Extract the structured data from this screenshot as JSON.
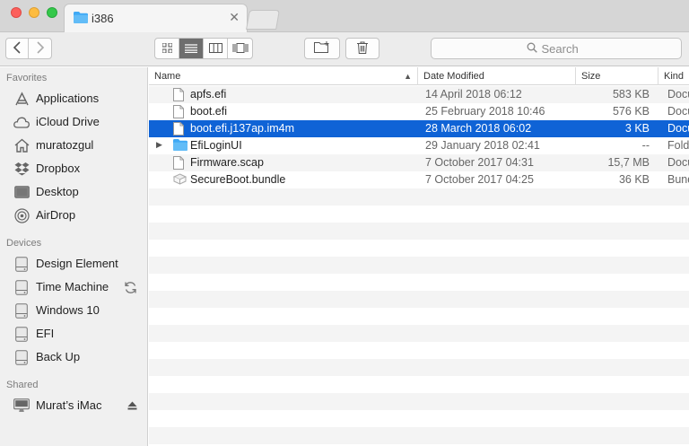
{
  "window": {
    "tab_title": "i386",
    "tab_close": "✕"
  },
  "toolbar": {
    "search_placeholder": "Search"
  },
  "sidebar": {
    "sections": [
      {
        "title": "Favorites",
        "items": [
          {
            "label": "Applications",
            "icon": "applications-icon"
          },
          {
            "label": "iCloud Drive",
            "icon": "cloud-icon"
          },
          {
            "label": "muratozgul",
            "icon": "home-icon"
          },
          {
            "label": "Dropbox",
            "icon": "dropbox-icon"
          },
          {
            "label": "Desktop",
            "icon": "desktop-icon"
          },
          {
            "label": "AirDrop",
            "icon": "airdrop-icon"
          }
        ]
      },
      {
        "title": "Devices",
        "items": [
          {
            "label": "Design Element",
            "icon": "disk-icon"
          },
          {
            "label": "Time Machine",
            "icon": "disk-icon",
            "extra": "sync-icon"
          },
          {
            "label": "Windows 10",
            "icon": "disk-icon"
          },
          {
            "label": "EFI",
            "icon": "disk-icon"
          },
          {
            "label": "Back Up",
            "icon": "disk-icon"
          }
        ]
      },
      {
        "title": "Shared",
        "items": [
          {
            "label": "Murat’s iMac",
            "icon": "imac-icon",
            "extra": "eject-icon"
          }
        ]
      }
    ]
  },
  "list": {
    "columns": {
      "name": "Name",
      "date": "Date Modified",
      "size": "Size",
      "kind": "Kind"
    },
    "sort_indicator": "▲",
    "disclosure": "▶",
    "rows": [
      {
        "name": "apfs.efi",
        "date": "14 April 2018 06:12",
        "size": "583 KB",
        "kind": "Docu",
        "icon": "document-icon",
        "selected": false
      },
      {
        "name": "boot.efi",
        "date": "25 February 2018 10:46",
        "size": "576 KB",
        "kind": "Docu",
        "icon": "document-icon",
        "selected": false
      },
      {
        "name": "boot.efi.j137ap.im4m",
        "date": "28 March 2018 06:02",
        "size": "3 KB",
        "kind": "Docu",
        "icon": "document-icon",
        "selected": true
      },
      {
        "name": "EfiLoginUI",
        "date": "29 January 2018 02:41",
        "size": "--",
        "kind": "Fold",
        "icon": "folder-icon",
        "selected": false,
        "expandable": true
      },
      {
        "name": "Firmware.scap",
        "date": "7 October 2017 04:31",
        "size": "15,7 MB",
        "kind": "Docu",
        "icon": "document-icon",
        "selected": false
      },
      {
        "name": "SecureBoot.bundle",
        "date": "7 October 2017 04:25",
        "size": "36 KB",
        "kind": "Bund",
        "icon": "bundle-icon",
        "selected": false
      }
    ]
  },
  "colors": {
    "selection": "#0f63d6",
    "folder": "#3fa9f5"
  }
}
